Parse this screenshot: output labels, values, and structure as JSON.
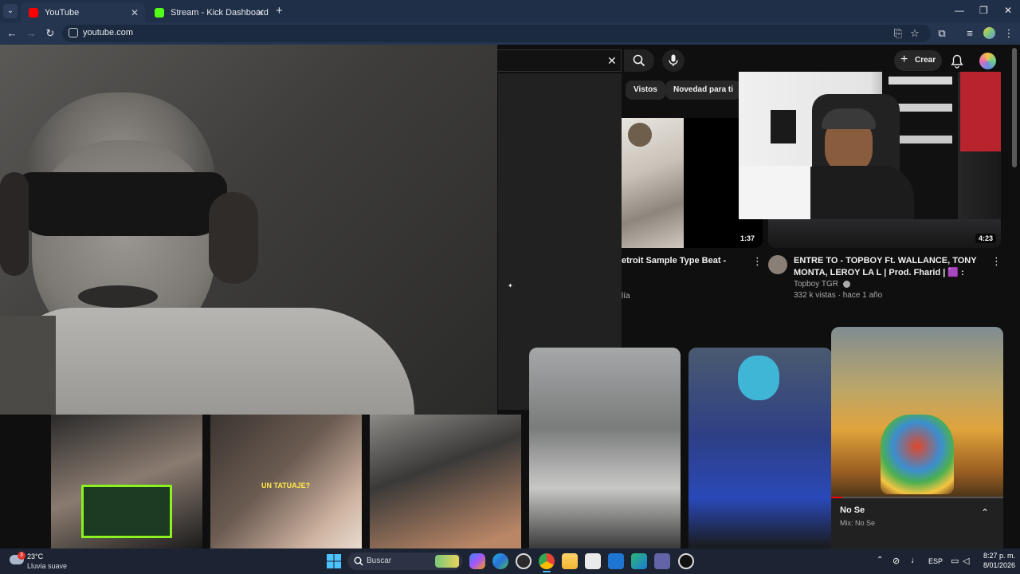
{
  "browser": {
    "tabs": [
      {
        "label": "YouTube",
        "close": "✕"
      },
      {
        "label": "Stream - Kick Dashboard",
        "close": "✕"
      }
    ],
    "new_tab": "+",
    "url": "youtube.com",
    "window_controls": {
      "minimize": "—",
      "restore": "❐",
      "close": "✕"
    }
  },
  "youtube": {
    "search_clear": "✕",
    "create_label": "Crear",
    "chips": [
      "Vistos",
      "Novedad para ti"
    ],
    "videos": [
      {
        "title": "etroit Sample Type Beat -",
        "meta": "lía",
        "duration": "1:37"
      },
      {
        "title": "ENTRE TO - TOPBOY Ft. WALLANCE, TONY MONTA, LEROY LA L | Prod. Fharid | 🟪 : Cuadro ...",
        "channel": "Topboy TGR",
        "stats": "332 k vistas · hace 1 año",
        "duration": "4:23"
      }
    ],
    "shorts": [
      {
        "caption": ""
      },
      {
        "caption": "UN TATUAJE?"
      },
      {
        "caption": ""
      },
      {
        "caption": ""
      },
      {
        "caption": ""
      }
    ],
    "miniplayer": {
      "title": "No Se",
      "subtitle": "Mix: No Se"
    }
  },
  "taskbar": {
    "weather_temp": "23°C",
    "weather_desc": "Lluvia suave",
    "weather_badge": "3",
    "search_placeholder": "Buscar",
    "lang": "ESP",
    "time": "8:27 p. m.",
    "date": "8/01/2026"
  },
  "colors": {
    "yt_bg": "#0f0f0f",
    "chip_bg": "#272727",
    "taskbar_bg": "#1c2433",
    "chrome_tab_bg": "#1f2f47",
    "active_tab": "#253550",
    "kick_green": "#53fc18",
    "youtube_red": "#ff0000"
  }
}
